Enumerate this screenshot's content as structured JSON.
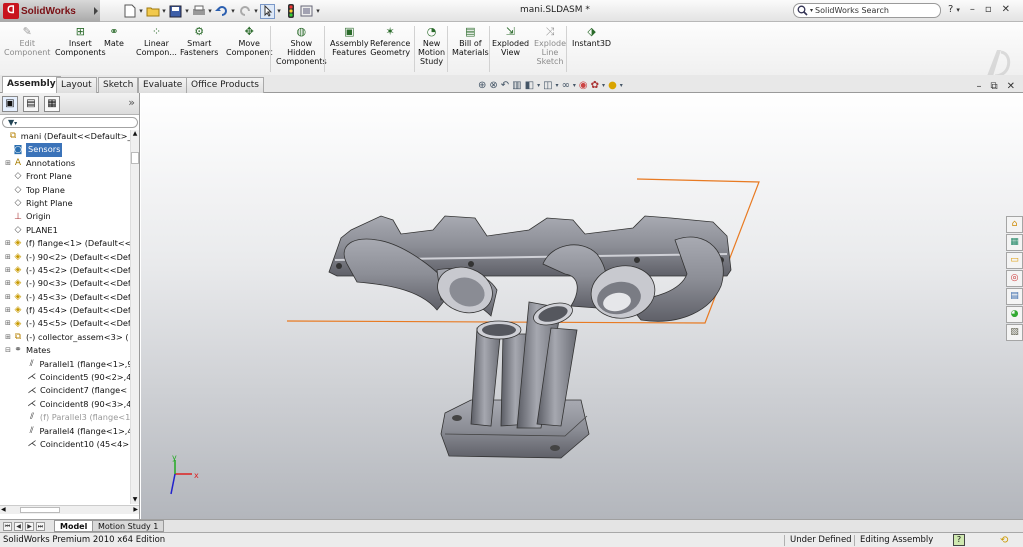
{
  "app": {
    "name": "SolidWorks",
    "doc_title": "mani.SLDASM *"
  },
  "search": {
    "placeholder": "SolidWorks Search"
  },
  "ribbon": [
    {
      "name": "edit-component-button",
      "label": "Edit\nComponent",
      "icon": "edit-component-icon",
      "disabled": true
    },
    {
      "name": "insert-components-button",
      "label": "Insert\nComponents",
      "icon": "insert-components-icon"
    },
    {
      "name": "mate-button",
      "label": "Mate",
      "icon": "mate-icon"
    },
    {
      "name": "linear-component-pattern-button",
      "label": "Linear\nCompon...",
      "icon": "linear-pattern-icon"
    },
    {
      "name": "smart-fasteners-button",
      "label": "Smart\nFasteners",
      "icon": "smart-fasteners-icon"
    },
    {
      "name": "move-component-button",
      "label": "Move\nComponent",
      "icon": "move-component-icon"
    },
    {
      "name": "show-hidden-components-button",
      "label": "Show\nHidden\nComponents",
      "icon": "show-hidden-icon"
    },
    {
      "name": "assembly-features-button",
      "label": "Assembly\nFeatures",
      "icon": "assembly-features-icon"
    },
    {
      "name": "reference-geometry-button",
      "label": "Reference\nGeometry",
      "icon": "reference-geometry-icon"
    },
    {
      "name": "new-motion-study-button",
      "label": "New\nMotion\nStudy",
      "icon": "motion-study-icon"
    },
    {
      "name": "bill-of-materials-button",
      "label": "Bill of\nMaterials",
      "icon": "bill-of-materials-icon"
    },
    {
      "name": "exploded-view-button",
      "label": "Exploded\nView",
      "icon": "exploded-view-icon"
    },
    {
      "name": "explode-line-sketch-button",
      "label": "Explode\nLine\nSketch",
      "icon": "explode-line-icon",
      "disabled": true
    },
    {
      "name": "instant3d-button",
      "label": "Instant3D",
      "icon": "instant3d-icon"
    }
  ],
  "tabs": [
    "Assembly",
    "Layout",
    "Sketch",
    "Evaluate",
    "Office Products"
  ],
  "tree": [
    {
      "label": "mani  (Default<<Default>_A",
      "icon": "assembly-icon",
      "toggle": "",
      "state": ""
    },
    {
      "label": "Sensors",
      "icon": "sensors-icon",
      "toggle": "",
      "state": "selected"
    },
    {
      "label": "Annotations",
      "icon": "annotations-icon",
      "toggle": "+",
      "state": ""
    },
    {
      "label": "Front Plane",
      "icon": "plane-icon",
      "toggle": "",
      "state": ""
    },
    {
      "label": "Top Plane",
      "icon": "plane-icon",
      "toggle": "",
      "state": ""
    },
    {
      "label": "Right Plane",
      "icon": "plane-icon",
      "toggle": "",
      "state": ""
    },
    {
      "label": "Origin",
      "icon": "origin-icon",
      "toggle": "",
      "state": ""
    },
    {
      "label": "PLANE1",
      "icon": "plane-icon",
      "toggle": "",
      "state": ""
    },
    {
      "label": "(f) flange<1> (Default<<",
      "icon": "part-icon",
      "toggle": "+",
      "state": ""
    },
    {
      "label": "(-) 90<2> (Default<<Def",
      "icon": "part-icon",
      "toggle": "+",
      "state": ""
    },
    {
      "label": "(-) 45<2> (Default<<Def",
      "icon": "part-icon",
      "toggle": "+",
      "state": ""
    },
    {
      "label": "(-) 90<3> (Default<<Def",
      "icon": "part-icon",
      "toggle": "+",
      "state": ""
    },
    {
      "label": "(-) 45<3> (Default<<Def",
      "icon": "part-icon",
      "toggle": "+",
      "state": ""
    },
    {
      "label": "(f) 45<4> (Default<<Def",
      "icon": "part-icon",
      "toggle": "+",
      "state": ""
    },
    {
      "label": "(-) 45<5> (Default<<Def",
      "icon": "part-icon",
      "toggle": "+",
      "state": ""
    },
    {
      "label": "(-) collector_assem<3> (",
      "icon": "subassembly-icon",
      "toggle": "+",
      "state": ""
    },
    {
      "label": "Mates",
      "icon": "mates-icon",
      "toggle": "−",
      "state": ""
    },
    {
      "label": "Parallel1 (flange<1>,9",
      "icon": "parallel-mate-icon",
      "toggle": "",
      "state": "child"
    },
    {
      "label": "Coincident5 (90<2>,4",
      "icon": "coincident-mate-icon",
      "toggle": "",
      "state": "child"
    },
    {
      "label": "Coincident7 (flange<",
      "icon": "coincident-mate-icon",
      "toggle": "",
      "state": "child"
    },
    {
      "label": "Coincident8 (90<3>,4",
      "icon": "coincident-mate-icon",
      "toggle": "",
      "state": "child"
    },
    {
      "label": "(f) Parallel3 (flange<1",
      "icon": "parallel-mate-icon",
      "toggle": "",
      "state": "suppressed"
    },
    {
      "label": "Parallel4 (flange<1>,4",
      "icon": "parallel-mate-icon",
      "toggle": "",
      "state": "child"
    },
    {
      "label": "Coincident10 (45<4>",
      "icon": "coincident-mate-icon",
      "toggle": "",
      "state": "child"
    }
  ],
  "bottom_tabs": [
    "Model",
    "Motion Study 1"
  ],
  "status": {
    "edition": "SolidWorks Premium 2010 x64 Edition",
    "definition": "Under Defined",
    "mode": "Editing Assembly"
  },
  "colors": {
    "accent": "#3b73b9",
    "model": "#8c8e96",
    "plane": "#e87a22"
  }
}
